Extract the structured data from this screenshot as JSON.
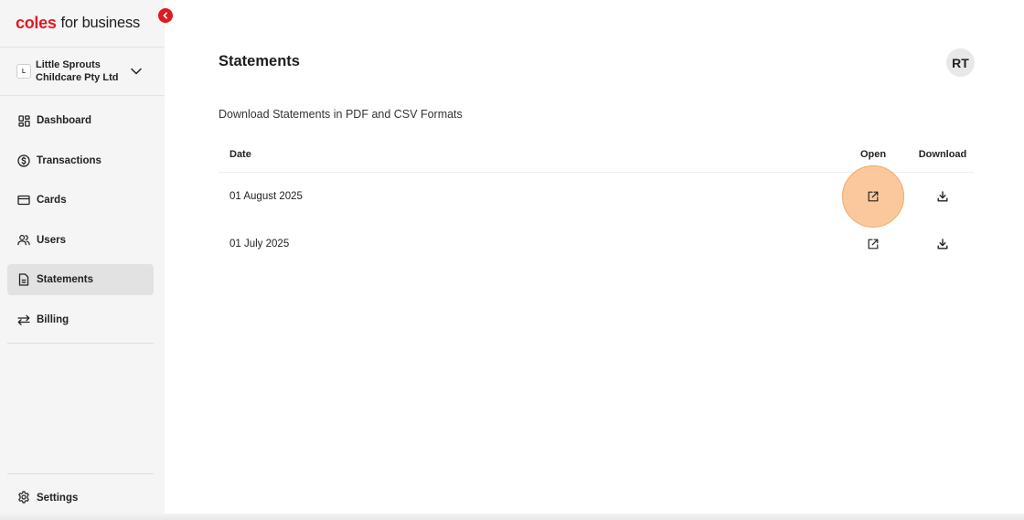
{
  "brand": {
    "name_red": "coles",
    "name_rest": "for business"
  },
  "org": {
    "badge": "L",
    "name": "Little Sprouts Childcare Pty Ltd"
  },
  "nav": {
    "items": [
      {
        "label": "Dashboard",
        "icon": "dashboard-icon"
      },
      {
        "label": "Transactions",
        "icon": "dollar-icon"
      },
      {
        "label": "Cards",
        "icon": "card-icon"
      },
      {
        "label": "Users",
        "icon": "users-icon"
      },
      {
        "label": "Statements",
        "icon": "document-icon",
        "active": true
      },
      {
        "label": "Billing",
        "icon": "swap-icon"
      }
    ],
    "settings": {
      "label": "Settings",
      "icon": "gear-icon"
    }
  },
  "header": {
    "title": "Statements",
    "avatar_initials": "RT"
  },
  "statements": {
    "subtitle": "Download Statements in PDF and CSV Formats",
    "columns": {
      "date": "Date",
      "open": "Open",
      "download": "Download"
    },
    "rows": [
      {
        "date": "01 August 2025"
      },
      {
        "date": "01 July 2025"
      }
    ]
  },
  "colors": {
    "brand_red": "#e01a22",
    "highlight": "#fabe8c",
    "active_nav": "#e2e2e2"
  }
}
